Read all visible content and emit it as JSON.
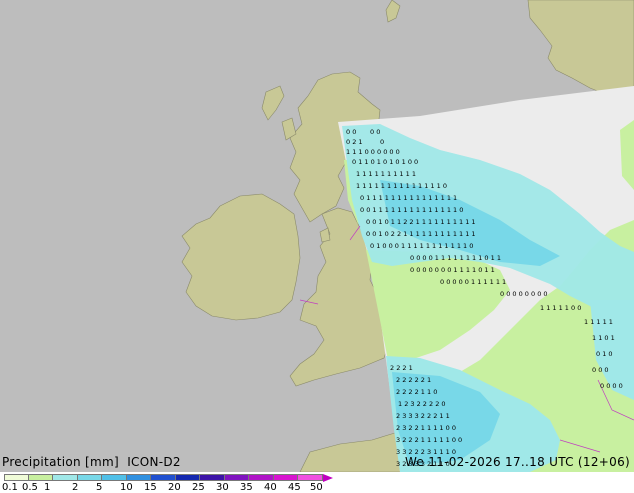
{
  "map": {
    "colors": {
      "sea": "#bdbdbd",
      "land": "#c8c896",
      "nodata": "#ececec",
      "light_precip": "#c8f0a0",
      "medium_precip": "#a0e8e8",
      "heavy_precip": "#78d8e8",
      "border": "#c040c0"
    }
  },
  "legend": {
    "title": "Precipitation [mm]  ICON-D2",
    "datetime": "We 11-02-2026 17..18 UTC (12+06)",
    "scale_labels": [
      "0.1",
      "0.5",
      "1",
      "2",
      "5",
      "10",
      "15",
      "20",
      "25",
      "30",
      "35",
      "40",
      "45",
      "50"
    ],
    "scale_colors": [
      "#f0fcd8",
      "#c8f0a0",
      "#a0e8e8",
      "#78d8e8",
      "#50c0e8",
      "#3090e0",
      "#2050d0",
      "#1428b0",
      "#3c14a8",
      "#8014c0",
      "#b014c8",
      "#d814d0",
      "#f050e0"
    ]
  }
}
